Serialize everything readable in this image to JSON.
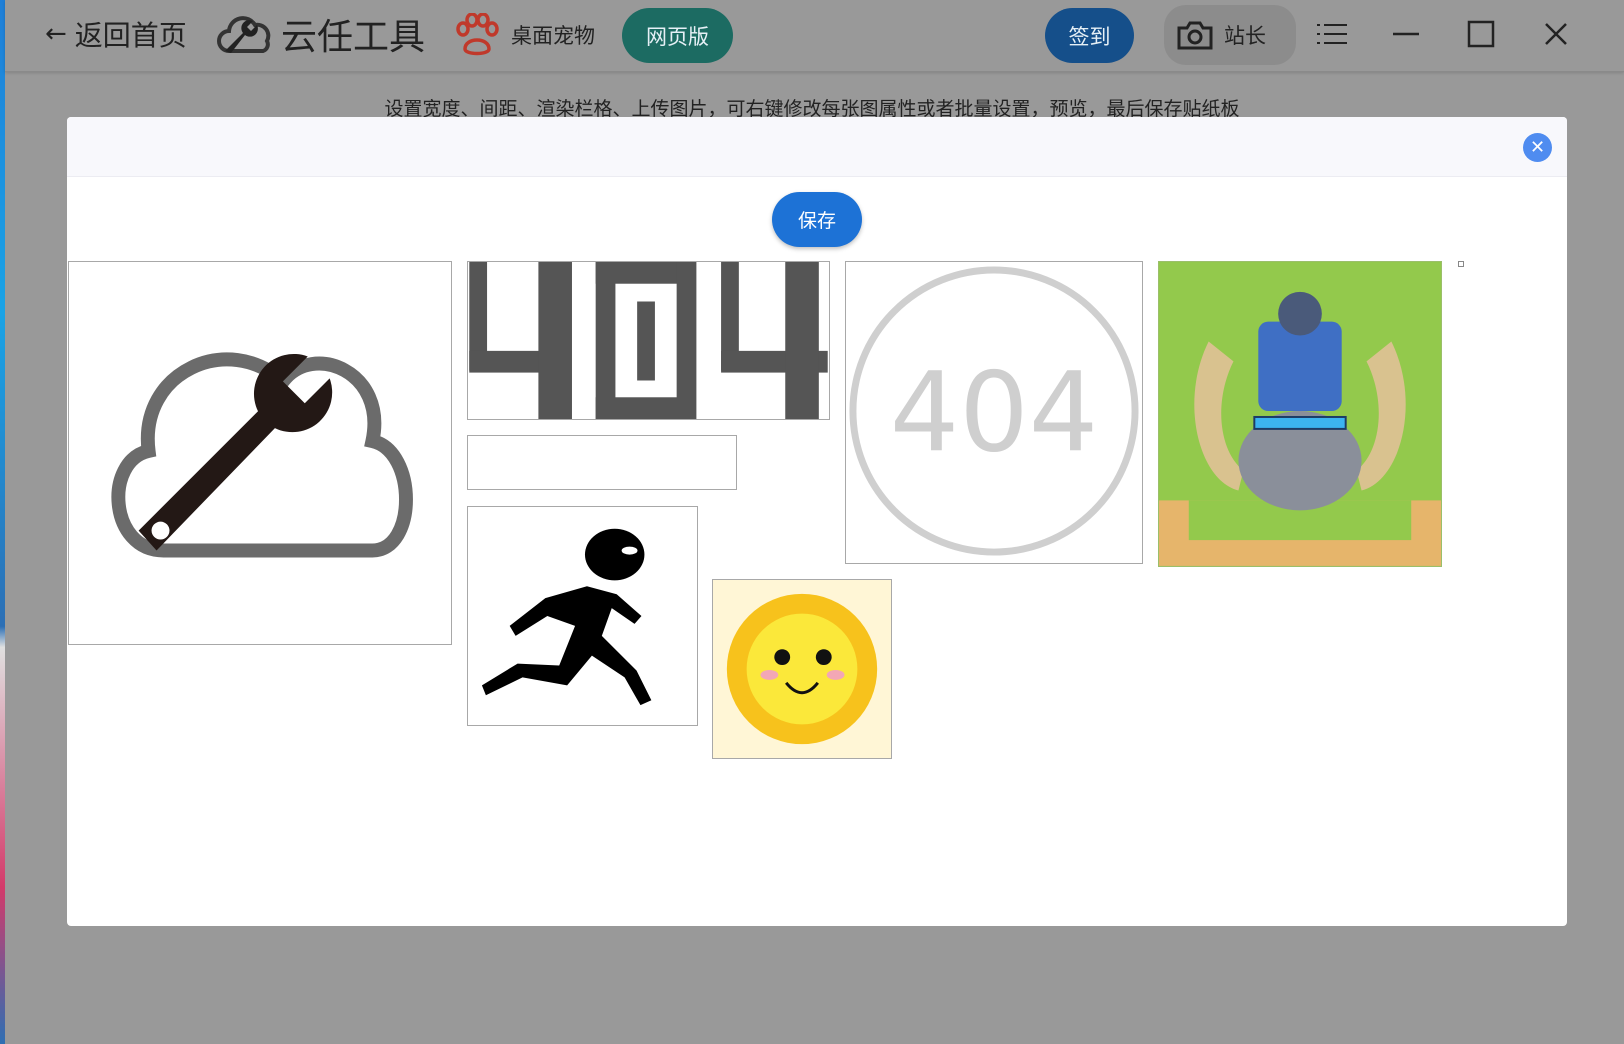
{
  "topbar": {
    "back_label": "返回首页",
    "brand_name": "云任工具",
    "pet_label": "桌面宠物",
    "web_version_label": "网页版",
    "signin_label": "签到",
    "owner_label": "站长"
  },
  "subtitle": "设置宽度、间距、渲染栏格、上传图片，可右键修改每张图属性或者批量设置，预览，最后保存贴纸板",
  "modal": {
    "save_label": "保存",
    "close_symbol": "✕"
  },
  "canvas_images": {
    "tile_404_digits": "404",
    "tile_404_circle": "404"
  },
  "icons": [
    "back-arrow-icon",
    "wrench-cloud-icon",
    "paw-icon",
    "camera-icon",
    "menu-icon",
    "minimize-icon",
    "maximize-icon",
    "close-icon"
  ],
  "colors": {
    "overlay": "#999999",
    "save_button": "#1d72d6",
    "web_version_button": "#1c6b62",
    "signin_button": "#154f8a",
    "modal_close": "#4f8cf0"
  }
}
